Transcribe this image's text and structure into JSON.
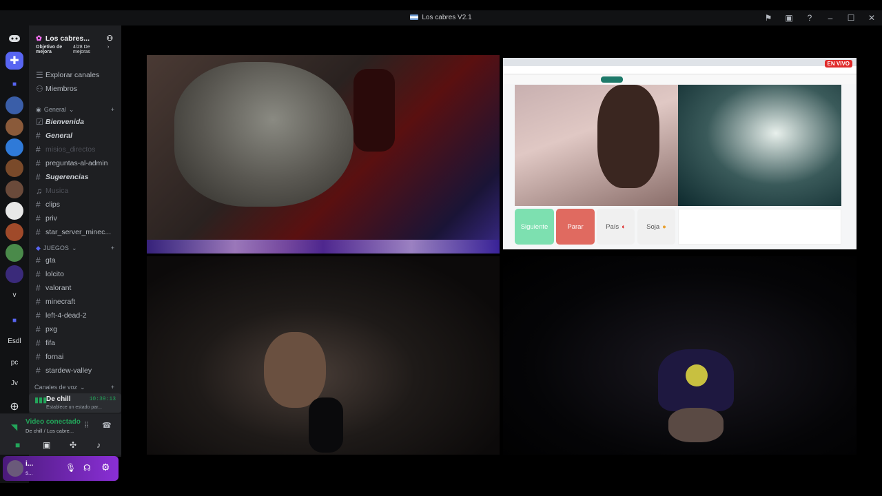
{
  "window": {
    "title": "Los cabres V2.1"
  },
  "server": {
    "name": "Los cabres...",
    "objective_label": "Objetivo de mejora",
    "boosts": "4/28 De mejoras"
  },
  "nav": {
    "explore": "Explorar canales",
    "members": "Miembros"
  },
  "categories": {
    "general": "General",
    "juegos": "JUEGOS",
    "voice": "Canales de voz"
  },
  "channels": {
    "bienvenida": "Bienvenida",
    "general": "General",
    "misios": "misios_directos",
    "preguntas": "preguntas-al-admin",
    "sugerencias": "Sugerencias",
    "musica": "Musica",
    "clips": "clips",
    "priv": "priv",
    "star": "star_server_minec...",
    "gta": "gta",
    "lolcito": "lolcito",
    "valorant": "valorant",
    "minecraft": "minecraft",
    "l4d2": "left-4-dead-2",
    "pxg": "pxg",
    "fifa": "fifa",
    "fornai": "fornai",
    "stardew": "stardew-valley"
  },
  "voice_channel": {
    "name": "De chill",
    "time": "10:39:13",
    "status": "Establece un estado par..."
  },
  "connection": {
    "status": "Video conectado",
    "location": "De chill / Los cabre..."
  },
  "user": {
    "name": "i...",
    "status": "s..."
  },
  "server_labels": {
    "v": "v",
    "esdl": "Esdl",
    "pc": "pc",
    "jv": "Jv"
  },
  "stream": {
    "live_badge": "EN VIVO",
    "btn_next": "Siguiente",
    "btn_stop": "Parar",
    "btn_country": "País",
    "btn_gender": "Soja"
  },
  "colors": {
    "accent": "#5865f2",
    "online": "#23a55a",
    "live": "#e02a2a"
  }
}
